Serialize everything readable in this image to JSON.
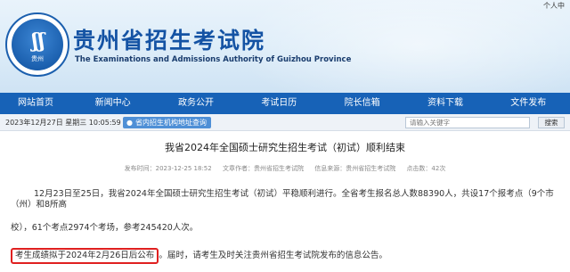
{
  "header": {
    "personal_center": "个人中",
    "logo_text": "贵州",
    "site_title": "贵州省招生考试院",
    "site_subtitle": "The Examinations and Admissions Authority of Guizhou Province"
  },
  "nav": {
    "items": [
      "网站首页",
      "新闻中心",
      "政务公开",
      "考试日历",
      "院长信箱",
      "资料下载",
      "文件发布"
    ]
  },
  "infobar": {
    "date": "2023年12月27日 星期三 10:05:59",
    "org_search_label": "省内招生机构地址查询",
    "search_placeholder": "请输入关键字",
    "search_button": "搜索"
  },
  "article": {
    "title": "我省2024年全国硕士研究生招生考试（初试）顺利结束",
    "meta": {
      "published": "发布时间：2023-12-25 18:52",
      "source": "文章作者：贵州省招生考试院",
      "origin": "信息来源：贵州省招生考试院",
      "views": "点击数：42次"
    },
    "p1_line1": "12月23日至25日，我省2024年全国硕士研究生招生考试（初试）平稳顺利进行。全省考生报名总人数88390人，共设17个报考点（9个市（州）和8所高",
    "p1_line2": "校），61个考点2974个考场，参考245420人次。",
    "p3_highlight": "考生成绩拟于2024年2月26日后公布",
    "p3_rest": "。届时，请考生及时关注贵州省招生考试院发布的信息公告。"
  }
}
